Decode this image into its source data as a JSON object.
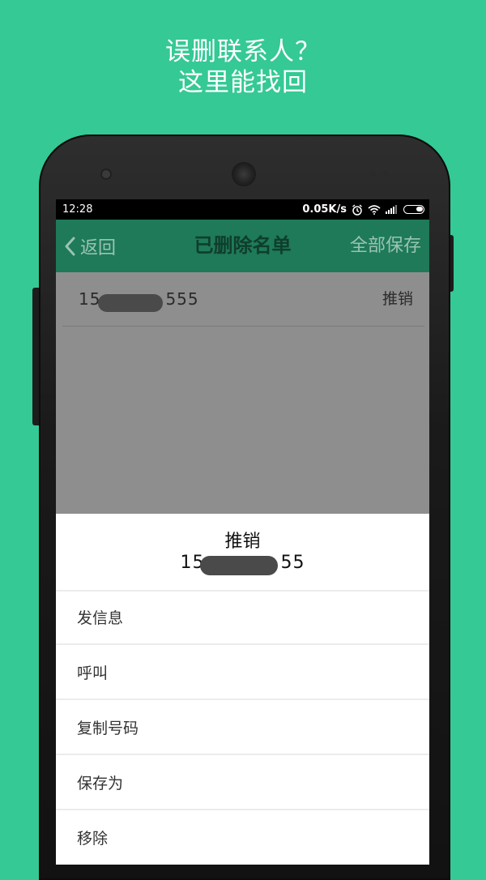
{
  "promo": {
    "line1": "误删联系人？",
    "line2": "这里能找回"
  },
  "status_bar": {
    "time": "12:28",
    "speed": "0.05K/s",
    "icons": [
      "alarm-icon",
      "wifi-icon",
      "signal-icon",
      "battery-icon"
    ]
  },
  "app_bar": {
    "back_label": "返回",
    "title": "已删除名单",
    "save_all_label": "全部保存"
  },
  "contact_list": [
    {
      "number_prefix": "15",
      "number_suffix": "555",
      "name": "推销"
    }
  ],
  "action_sheet": {
    "name": "推销",
    "number_prefix": "15",
    "number_suffix": "55",
    "items": [
      "发信息",
      "呼叫",
      "复制号码",
      "保存为",
      "移除"
    ]
  },
  "colors": {
    "background": "#34c995",
    "app_bar": "#1e7a58",
    "overlay": "#8e8e8e"
  }
}
